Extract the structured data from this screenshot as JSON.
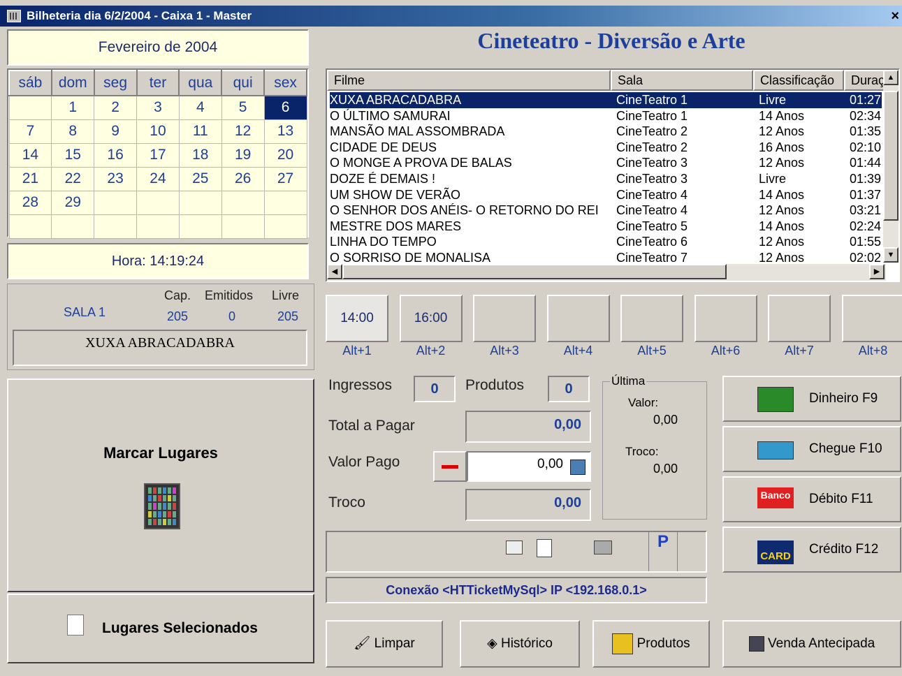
{
  "window": {
    "title": "Bilheteria dia 6/2/2004  -  Caixa 1  -  Master",
    "close_glyph": "×"
  },
  "calendar": {
    "month_label": "Fevereiro de 2004",
    "weekdays": [
      "sáb",
      "dom",
      "seg",
      "ter",
      "qua",
      "qui",
      "sex"
    ],
    "weeks": [
      [
        "",
        "1",
        "2",
        "3",
        "4",
        "5",
        "6"
      ],
      [
        "7",
        "8",
        "9",
        "10",
        "11",
        "12",
        "13"
      ],
      [
        "14",
        "15",
        "16",
        "17",
        "18",
        "19",
        "20"
      ],
      [
        "21",
        "22",
        "23",
        "24",
        "25",
        "26",
        "27"
      ],
      [
        "28",
        "29",
        "",
        "",
        "",
        "",
        ""
      ],
      [
        "",
        "",
        "",
        "",
        "",
        "",
        ""
      ]
    ],
    "selected_day": "6"
  },
  "clock": {
    "label": "Hora: 14:19:24"
  },
  "sala": {
    "name": "SALA 1",
    "cap_label": "Cap.",
    "emitidos_label": "Emitidos",
    "livre_label": "Livre",
    "cap": "205",
    "emitidos": "0",
    "livre": "205",
    "movie": "XUXA   ABRACADABRA"
  },
  "left_buttons": {
    "marcar": "Marcar Lugares",
    "lugares": "Lugares Selecionados"
  },
  "header": {
    "title": "Cineteatro - Diversão e Arte"
  },
  "film_list": {
    "columns": [
      "Filme",
      "Sala",
      "Classificação",
      "Duraç"
    ],
    "rows": [
      [
        "XUXA   ABRACADABRA",
        "CineTeatro 1",
        "Livre",
        "01:27"
      ],
      [
        "O ÚLTIMO SAMURAI",
        "CineTeatro 1",
        "14 Anos",
        "02:34"
      ],
      [
        "MANSÃO   MAL   ASSOMBRADA",
        "CineTeatro 2",
        "12 Anos",
        "01:35"
      ],
      [
        " CIDADE DE DEUS",
        "CineTeatro 2",
        "16 Anos",
        "02:10"
      ],
      [
        "O MONGE A PROVA DE BALAS",
        "CineTeatro 3",
        "12 Anos",
        "01:44"
      ],
      [
        "DOZE É DEMAIS !",
        "CineTeatro 3",
        "Livre",
        "01:39"
      ],
      [
        "UM SHOW DE VERÃO",
        "CineTeatro 4",
        "14 Anos",
        "01:37"
      ],
      [
        "O SENHOR DOS ANÉIS- O RETORNO DO REI",
        "CineTeatro 4",
        "12 Anos",
        "03:21"
      ],
      [
        "MESTRE DOS MARES",
        "CineTeatro 5",
        "14 Anos",
        "02:24"
      ],
      [
        "LINHA DO TEMPO",
        "CineTeatro 6",
        "12 Anos",
        "01:55"
      ],
      [
        "O SORRISO DE MONALISA",
        "CineTeatro 7",
        "12 Anos",
        "02:02"
      ]
    ],
    "selected_index": 0
  },
  "sessions": {
    "times": [
      "14:00",
      "16:00",
      "",
      "",
      "",
      "",
      "",
      ""
    ],
    "shortcuts": [
      "Alt+1",
      "Alt+2",
      "Alt+3",
      "Alt+4",
      "Alt+5",
      "Alt+6",
      "Alt+7",
      "Alt+8"
    ]
  },
  "sale": {
    "ingressos_label": "Ingressos",
    "ingressos": "0",
    "produtos_label": "Produtos",
    "produtos": "0",
    "total_label": "Total a Pagar",
    "total": "0,00",
    "valor_pago_label": "Valor Pago",
    "valor_pago": "0,00",
    "troco_label": "Troco",
    "troco": "0,00"
  },
  "ultima": {
    "legend": "Última",
    "valor_label": "Valor:",
    "valor": "0,00",
    "troco_label": "Troco:",
    "troco": "0,00"
  },
  "payments": [
    {
      "label": "Dinheiro  F9",
      "icon": "money-icon"
    },
    {
      "label": "Chegue  F10",
      "icon": "check-icon"
    },
    {
      "label": "Débito  F11",
      "icon": "bank-icon",
      "icon_text": "Banco"
    },
    {
      "label": "Crédito  F12",
      "icon": "card-icon",
      "icon_text": "CARD"
    }
  ],
  "status": {
    "p_label": "P",
    "connection": "Conexão <HTTicketMySql> IP <192.168.0.1>"
  },
  "bottom_buttons": {
    "limpar": "Limpar",
    "historico": "Histórico",
    "produtos": "Produtos",
    "venda": "Venda Antecipada"
  },
  "colors": {
    "accent": "#0a246a",
    "text_blue": "#1e3f96",
    "panel": "#d4d0c8",
    "cal_bg": "#ffffe1"
  }
}
